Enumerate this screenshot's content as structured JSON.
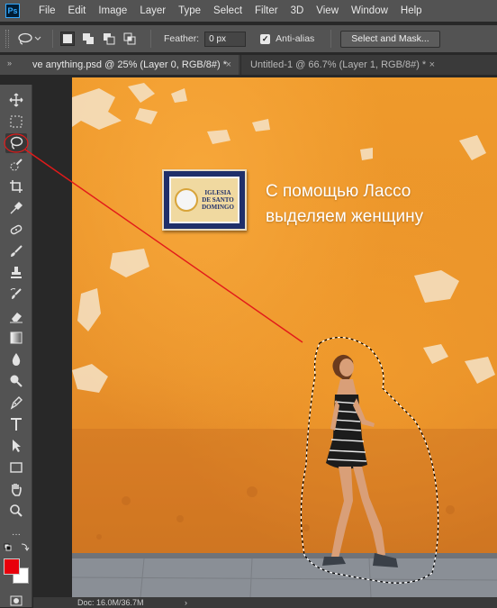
{
  "menubar": {
    "logo": "Ps",
    "items": [
      "File",
      "Edit",
      "Image",
      "Layer",
      "Type",
      "Select",
      "Filter",
      "3D",
      "View",
      "Window",
      "Help"
    ]
  },
  "options": {
    "feather_label": "Feather:",
    "feather_value": "0 px",
    "antialias_label": "Anti-alias",
    "antialias_checked": true,
    "select_mask_button": "Select and Mask..."
  },
  "tabs": {
    "collapse_glyph": "»",
    "active_label": "ve anything.psd @ 25% (Layer 0, RGB/8#) *",
    "inactive_label": "Untitled-1 @ 66.7% (Layer 1, RGB/8#) *",
    "close_glyph": "×"
  },
  "canvas": {
    "caption_line1": "С помощью Лассо",
    "caption_line2": "выделяем женщину",
    "sign_line1": "IGLESIA",
    "sign_line2": "DE SANTO",
    "sign_line3": "DOMINGO"
  },
  "colors": {
    "foreground": "#e8000b",
    "background": "#ffffff",
    "annotation_line": "#e21a1a",
    "wall": "#ee9a2c"
  },
  "tools": [
    "move-icon",
    "marquee-icon",
    "lasso-icon",
    "quick-select-icon",
    "crop-icon",
    "eyedropper-icon",
    "healing-icon",
    "brush-icon",
    "clone-stamp-icon",
    "history-brush-icon",
    "eraser-icon",
    "gradient-icon",
    "blur-icon",
    "dodge-icon",
    "pen-icon",
    "type-icon",
    "path-select-icon",
    "rectangle-icon",
    "hand-icon",
    "zoom-icon"
  ],
  "status": {
    "doc": "Doc: 16.0M/36.7M",
    "arrow": "›"
  }
}
